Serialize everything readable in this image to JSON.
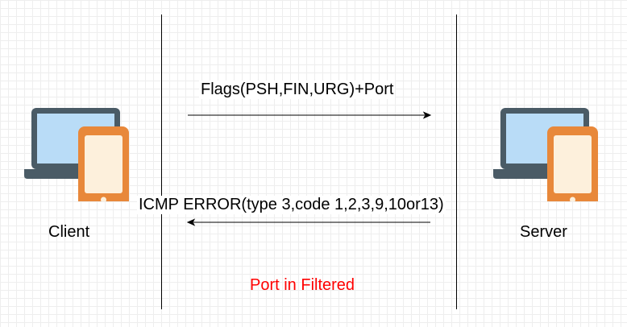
{
  "nodes": {
    "client": {
      "label": "Client",
      "icon": "laptop-phone-icon"
    },
    "server": {
      "label": "Server",
      "icon": "laptop-phone-icon"
    }
  },
  "messages": {
    "request": {
      "label": "Flags(PSH,FIN,URG)+Port",
      "direction": "client-to-server"
    },
    "response": {
      "label": "ICMP ERROR(type 3,code 1,2,3,9,10or13)",
      "direction": "server-to-client"
    }
  },
  "result": {
    "label": "Port in Filtered"
  },
  "colors": {
    "laptop_frame": "#4a5b66",
    "laptop_screen": "#b9dcf7",
    "phone_body": "#e8883a",
    "phone_screen": "#fdf0dc",
    "result_text": "#ff0000",
    "line": "#000000"
  }
}
